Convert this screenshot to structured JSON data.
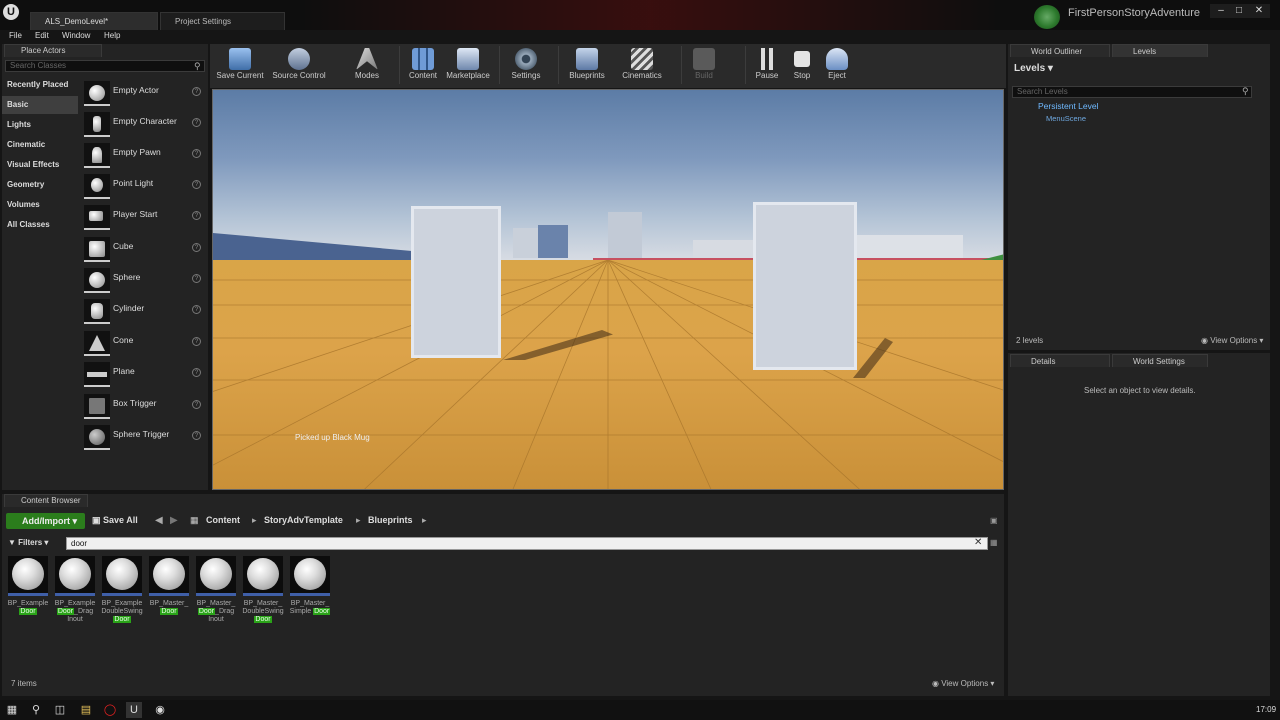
{
  "window": {
    "tabs": [
      {
        "label": "ALS_DemoLevel*",
        "active": true
      },
      {
        "label": "Project Settings",
        "active": false
      }
    ],
    "project_name": "FirstPersonStoryAdventure",
    "controls": {
      "minimize": "–",
      "maximize": "□",
      "close": "✕"
    }
  },
  "menu": [
    "File",
    "Edit",
    "Window",
    "Help"
  ],
  "place_actors": {
    "tab_label": "Place Actors",
    "search_placeholder": "Search Classes",
    "categories": [
      "Recently Placed",
      "Basic",
      "Lights",
      "Cinematic",
      "Visual Effects",
      "Geometry",
      "Volumes",
      "All Classes"
    ],
    "selected_category": "Basic",
    "items": [
      "Empty Actor",
      "Empty Character",
      "Empty Pawn",
      "Point Light",
      "Player Start",
      "Cube",
      "Sphere",
      "Cylinder",
      "Cone",
      "Plane",
      "Box Trigger",
      "Sphere Trigger"
    ]
  },
  "toolbar": {
    "buttons": [
      {
        "label": "Save Current",
        "icon": "save-icon",
        "color": "#6b9bd1"
      },
      {
        "label": "Source Control",
        "icon": "source-control-icon",
        "color": "#7f8fa6"
      },
      {
        "label": "Modes",
        "icon": "modes-icon",
        "color": "#b0b0b0"
      },
      {
        "label": "Content",
        "icon": "content-icon",
        "color": "#5a8ac8"
      },
      {
        "label": "Marketplace",
        "icon": "marketplace-icon",
        "color": "#8aa0c0"
      },
      {
        "label": "Settings",
        "icon": "settings-icon",
        "color": "#9aa"
      },
      {
        "label": "Blueprints",
        "icon": "blueprints-icon",
        "color": "#8fa8c8"
      },
      {
        "label": "Cinematics",
        "icon": "cinematics-icon",
        "color": "#bbb"
      },
      {
        "label": "Build",
        "icon": "build-icon",
        "color": "#555"
      },
      {
        "label": "Pause",
        "icon": "pause-icon",
        "color": "#ddd"
      },
      {
        "label": "Stop",
        "icon": "stop-icon",
        "color": "#ddd"
      },
      {
        "label": "Eject",
        "icon": "eject-icon",
        "color": "#8fb0d8"
      }
    ]
  },
  "viewport": {
    "message": "Picked up Black Mug"
  },
  "world_outliner": {
    "tabs": [
      "World Outliner",
      "Levels"
    ],
    "levels_button": "Levels",
    "search_placeholder": "Search Levels",
    "tree": [
      {
        "label": "Persistent Level",
        "depth": 0
      },
      {
        "label": "MenuScene",
        "depth": 1
      }
    ],
    "count": "2 levels",
    "view_options": "View Options"
  },
  "details": {
    "tabs": [
      "Details",
      "World Settings"
    ],
    "empty_message": "Select an object to view details."
  },
  "content_browser": {
    "tab_label": "Content Browser",
    "add_import": "Add/Import",
    "save_all": "Save All",
    "breadcrumb": [
      "Content",
      "StoryAdvTemplate",
      "Blueprints"
    ],
    "filters": "Filters",
    "search_value": "door",
    "assets": [
      {
        "pre": "BP_Example",
        "hl": "Door",
        "post": ""
      },
      {
        "pre": "BP_Example",
        "hl": "Door",
        "post": "_Drag Inout"
      },
      {
        "pre": "BP_Example DoubleSwing",
        "hl": "Door",
        "post": ""
      },
      {
        "pre": "BP_Master_",
        "hl": "Door",
        "post": ""
      },
      {
        "pre": "BP_Master_",
        "hl": "Door",
        "post": "_Drag Inout"
      },
      {
        "pre": "BP_Master_ DoubleSwing",
        "hl": "Door",
        "post": ""
      },
      {
        "pre": "BP_Master_ Simple",
        "hl": "Door",
        "post": ""
      }
    ],
    "item_count": "7 items",
    "view_options": "View Options"
  },
  "taskbar": {
    "time": "17:09"
  }
}
